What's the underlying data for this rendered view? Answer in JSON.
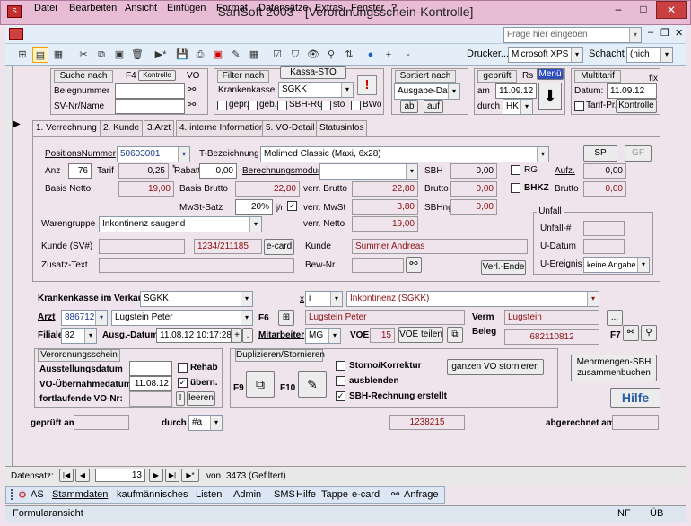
{
  "window": {
    "title": "SanSoft 2003 - [Verordnungsschein-Kontrolle]",
    "min": "–",
    "max": "□",
    "close": "✕"
  },
  "menu": [
    "Datei",
    "Bearbeiten",
    "Ansicht",
    "Einfügen",
    "Format",
    "Datensätze",
    "Extras",
    "Fenster",
    "?"
  ],
  "help_search": {
    "placeholder": "Frage hier eingeben"
  },
  "toolbar": {
    "printer_label": "Drucker...",
    "printer": "Microsoft XPS",
    "shaft_label": "Schacht",
    "shaft": "(nich"
  },
  "search": {
    "title": "Suche nach",
    "f4": "F4",
    "kontrolle": "Kontrolle",
    "vo": "VO",
    "belegnummer": "Belegnummer",
    "svnr": "SV-Nr/Name"
  },
  "filter": {
    "title": "Filter nach",
    "kassa_sto": "Kassa-STO",
    "krankenkasse": "Krankenkasse",
    "kk_value": "SGKK",
    "gepr": "gepr.",
    "geb": "geb.",
    "sbh_rg": "SBH-RG",
    "sto": "sto",
    "bwo": "BWo"
  },
  "sort": {
    "title": "Sortiert nach",
    "value": "Ausgabe-Dat",
    "ab": "ab",
    "auf": "auf"
  },
  "checked": {
    "title": "geprüft",
    "rs": "Rs",
    "menu": "Menü",
    "am": "am",
    "am_value": "11.09.12",
    "durch": "durch",
    "durch_value": "HK"
  },
  "multitarif": {
    "title": "Multitarif",
    "fix": "fix",
    "datum_label": "Datum:",
    "datum": "11.09.12",
    "tarif_pr": "Tarif-Pr.",
    "kontrolle": "Kontrolle"
  },
  "tabs": [
    "1. Verrechnung",
    "2. Kunde",
    "3.Arzt",
    "4. interne Information",
    "5. VO-Detail",
    "Statusinfos"
  ],
  "pos": {
    "positionsnummer_label": "PositionsNummer",
    "positionsnummer": "50603001",
    "tbez_label": "T-Bezeichnung",
    "tbez": "Molimed Classic (Maxi, 6x28)",
    "sp": "SP",
    "gf": "GF",
    "anz_label": "Anz",
    "anz": "76",
    "tarif_label": "Tarif",
    "tarif": "0,25",
    "rabatt_label": "Rabatt",
    "rabatt": "0,00",
    "berechnungsmodus": "Berechnungsmodus",
    "sbh_label": "SBH",
    "sbh": "0,00",
    "rg": "RG",
    "aufz_label": "Aufz.",
    "aufz": "0,00",
    "basis_netto_label": "Basis Netto",
    "basis_netto": "19,00",
    "basis_brutto_label": "Basis Brutto",
    "basis_brutto": "22,80",
    "verr_brutto_label": "verr. Brutto",
    "verr_brutto": "22,80",
    "brutto_label": "Brutto",
    "brutto": "0,00",
    "bhkz": "BHKZ",
    "brutto2_label": "Brutto",
    "brutto2": "0,00",
    "mwst_label": "MwSt-Satz",
    "mwst": "20%",
    "jn": "j/n",
    "verr_mwst_label": "verr. MwSt",
    "verr_mwst": "3,80",
    "sbhng_label": "SBHng",
    "sbhng": "0,00",
    "warengruppe_label": "Warengruppe",
    "warengruppe": "Inkontinenz saugend",
    "verr_netto_label": "verr. Netto",
    "verr_netto": "19,00",
    "kunde_sv_label": "Kunde (SV#)",
    "kunde_sv": "1234/211185",
    "ecard": "e-card",
    "kunde_label": "Kunde",
    "kunde": "Summer Andreas",
    "zusatz_label": "Zusatz-Text",
    "bewnr_label": "Bew-Nr.",
    "verl_ende": "Verl.-Ende"
  },
  "unfall": {
    "title": "Unfall",
    "nr": "Unfall-#",
    "datum": "U-Datum",
    "ereignis": "U-Ereignis",
    "ereignis_value": "keine Angabe"
  },
  "lower": {
    "kk_label": "Krankenkasse im Verkauf",
    "kk": "SGKK",
    "x_label": "x",
    "x_value": "i",
    "kk_desc": "Inkontinenz (SGKK)",
    "arzt_label": "Arzt",
    "arzt_nr": "886712",
    "arzt_name": "Lugstein Peter",
    "f6": "F6",
    "arzt_red": "Lugstein Peter",
    "verm_label": "Verm",
    "verm": "Lugstein",
    "dots": "...",
    "filiale_label": "Filiale",
    "filiale": "82",
    "ausg_label": "Ausg.-Datum",
    "ausg": "11.08.12 10:17:28",
    "plus": "+",
    "dot": ".",
    "mitarbeiter_label": "Mitarbeiter",
    "mitarbeiter": "MG",
    "voe_label": "VOE",
    "voe": "15",
    "voe_teilen": "VOE teilen",
    "beleg_label": "Beleg",
    "beleg": "682110812",
    "f7": "F7"
  },
  "vo": {
    "title": "Verordnungsschein",
    "ausstellung": "Ausstellungsdatum",
    "rehab": "Rehab",
    "uebernahme": "VO-Übernahmedatum",
    "uebernahme_value": "11.08.12",
    "uebern": "übern.",
    "fortlaufend": "fortlaufende VO-Nr:",
    "excl": "!",
    "leeren": "leeren"
  },
  "dup": {
    "title": "Duplizieren/Stornieren",
    "f9": "F9",
    "f10": "F10",
    "storno": "Storno/Korrektur",
    "ausblenden": "ausblenden",
    "sbh_rg": "SBH-Rechnung erstellt",
    "ganzen": "ganzen VO stornieren"
  },
  "mehrmengen": "Mehrmengen-SBH zusammenbuchen",
  "hilfe": "Hilfe",
  "footer": {
    "geprueft_label": "geprüft am",
    "durch_label": "durch",
    "durch": "#a",
    "number": "1238215",
    "abgerechnet_label": "abgerechnet am"
  },
  "nav": {
    "label": "Datensatz:",
    "current": "13",
    "of": "von",
    "total": "3473 (Gefiltert)"
  },
  "bottombar": [
    "AS",
    "Stammdaten",
    "kaufmännisches",
    "Listen",
    "Admin",
    "SMS",
    "Hilfe",
    "Tappe",
    "e-card",
    "Anfrage"
  ],
  "statusbar": {
    "left": "Formularansicht",
    "nf": "NF",
    "ue": "ÜB"
  }
}
